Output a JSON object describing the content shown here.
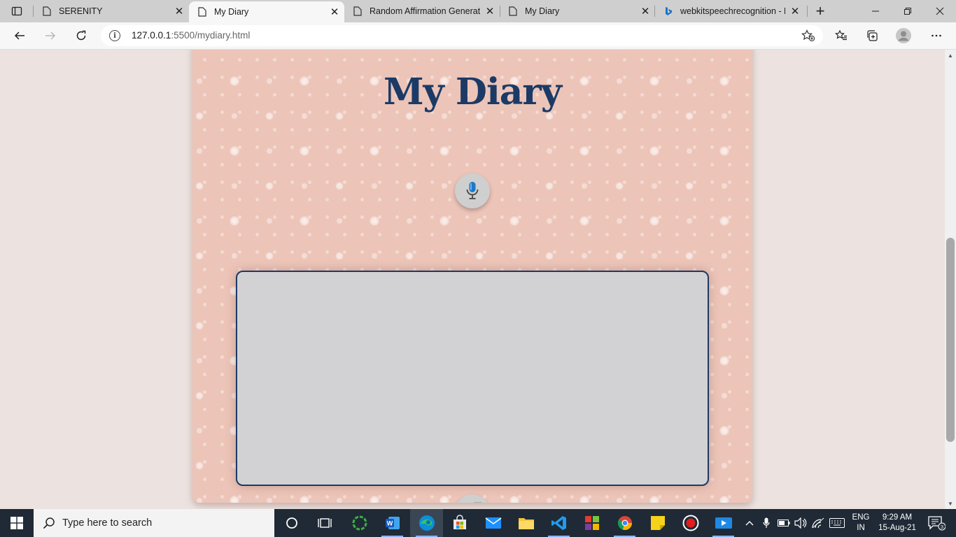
{
  "browser": {
    "tabs": [
      {
        "title": "SERENITY",
        "favicon": "page-icon",
        "active": false
      },
      {
        "title": "My Diary",
        "favicon": "page-icon",
        "active": true
      },
      {
        "title": "Random Affirmation Generat",
        "favicon": "page-icon",
        "active": false
      },
      {
        "title": "My Diary",
        "favicon": "page-icon",
        "active": false
      },
      {
        "title": "webkitspeechrecognition - Bi",
        "favicon": "bing-icon",
        "active": false
      }
    ],
    "url_host": "127.0.0.1",
    "url_path": ":5500/mydiary.html"
  },
  "page": {
    "title": "My Diary",
    "textarea_value": "",
    "card_color": "#ecc4b8",
    "title_color": "#1b3a66"
  },
  "taskbar": {
    "search_placeholder": "Type here to search",
    "lang_line1": "ENG",
    "lang_line2": "IN",
    "time": "9:29 AM",
    "date": "15-Aug-21",
    "notification_count": "3"
  }
}
